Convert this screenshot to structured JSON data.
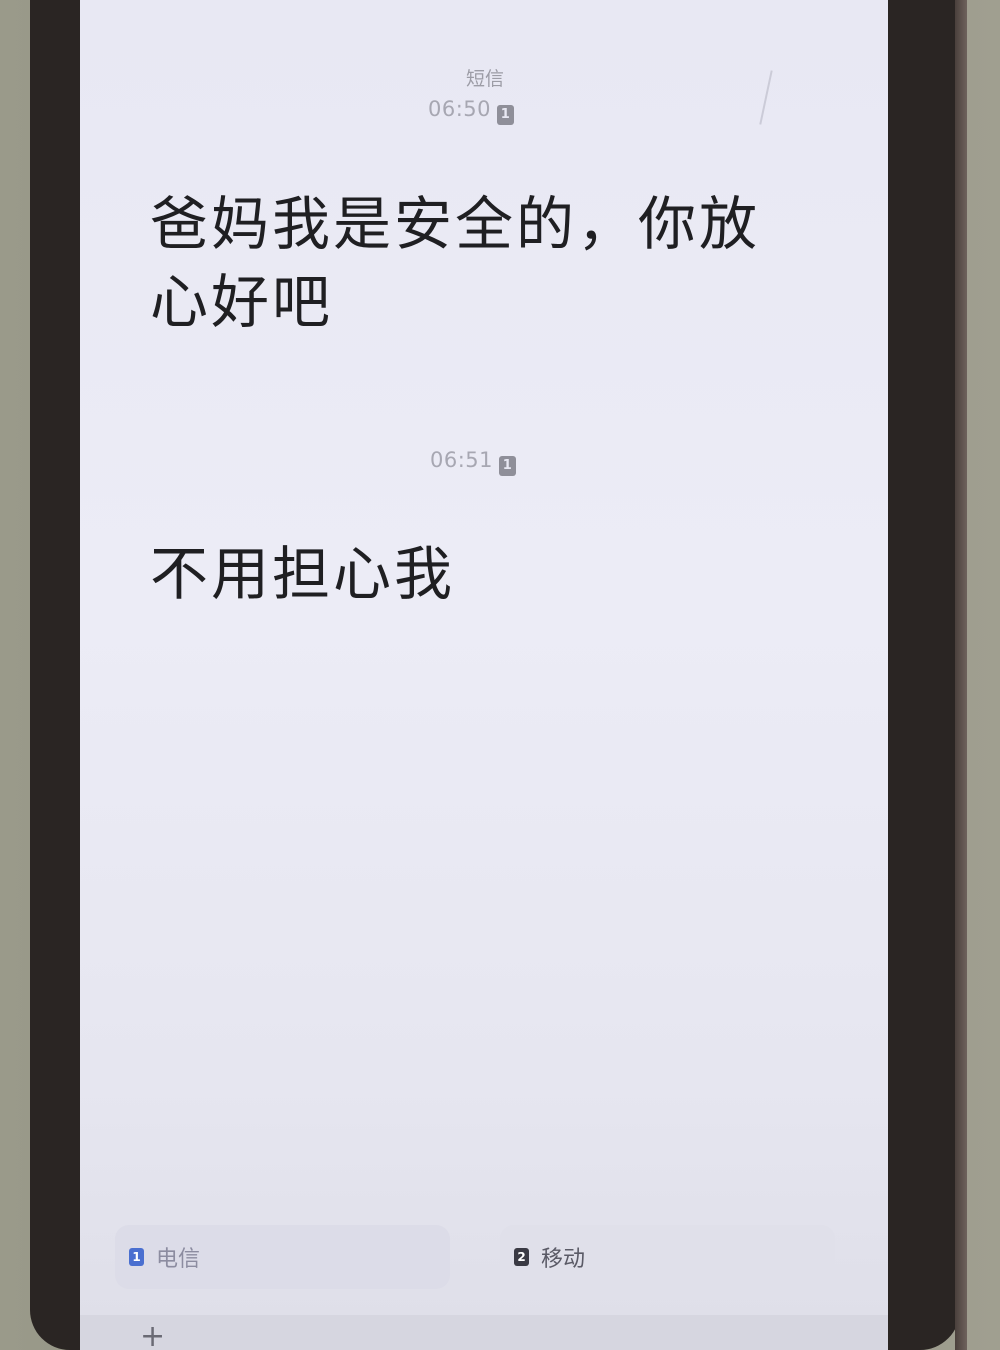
{
  "header": {
    "sim_label": "短信"
  },
  "messages": [
    {
      "time": "06:50",
      "sim": "1",
      "text": "爸妈我是安全的，你放心好吧"
    },
    {
      "time": "06:51",
      "sim": "1",
      "text": "不用担心我"
    }
  ],
  "bottom_bar": {
    "sim1": {
      "chip": "1",
      "label": "电信"
    },
    "sim2": {
      "chip": "2",
      "label": "移动"
    },
    "add_symbol": "+"
  },
  "colors": {
    "screen_bg": "#ececf6",
    "message_text": "#1f1f22",
    "timestamp": "#a7a7b2",
    "sim1_chip": "#4a6fd0"
  }
}
